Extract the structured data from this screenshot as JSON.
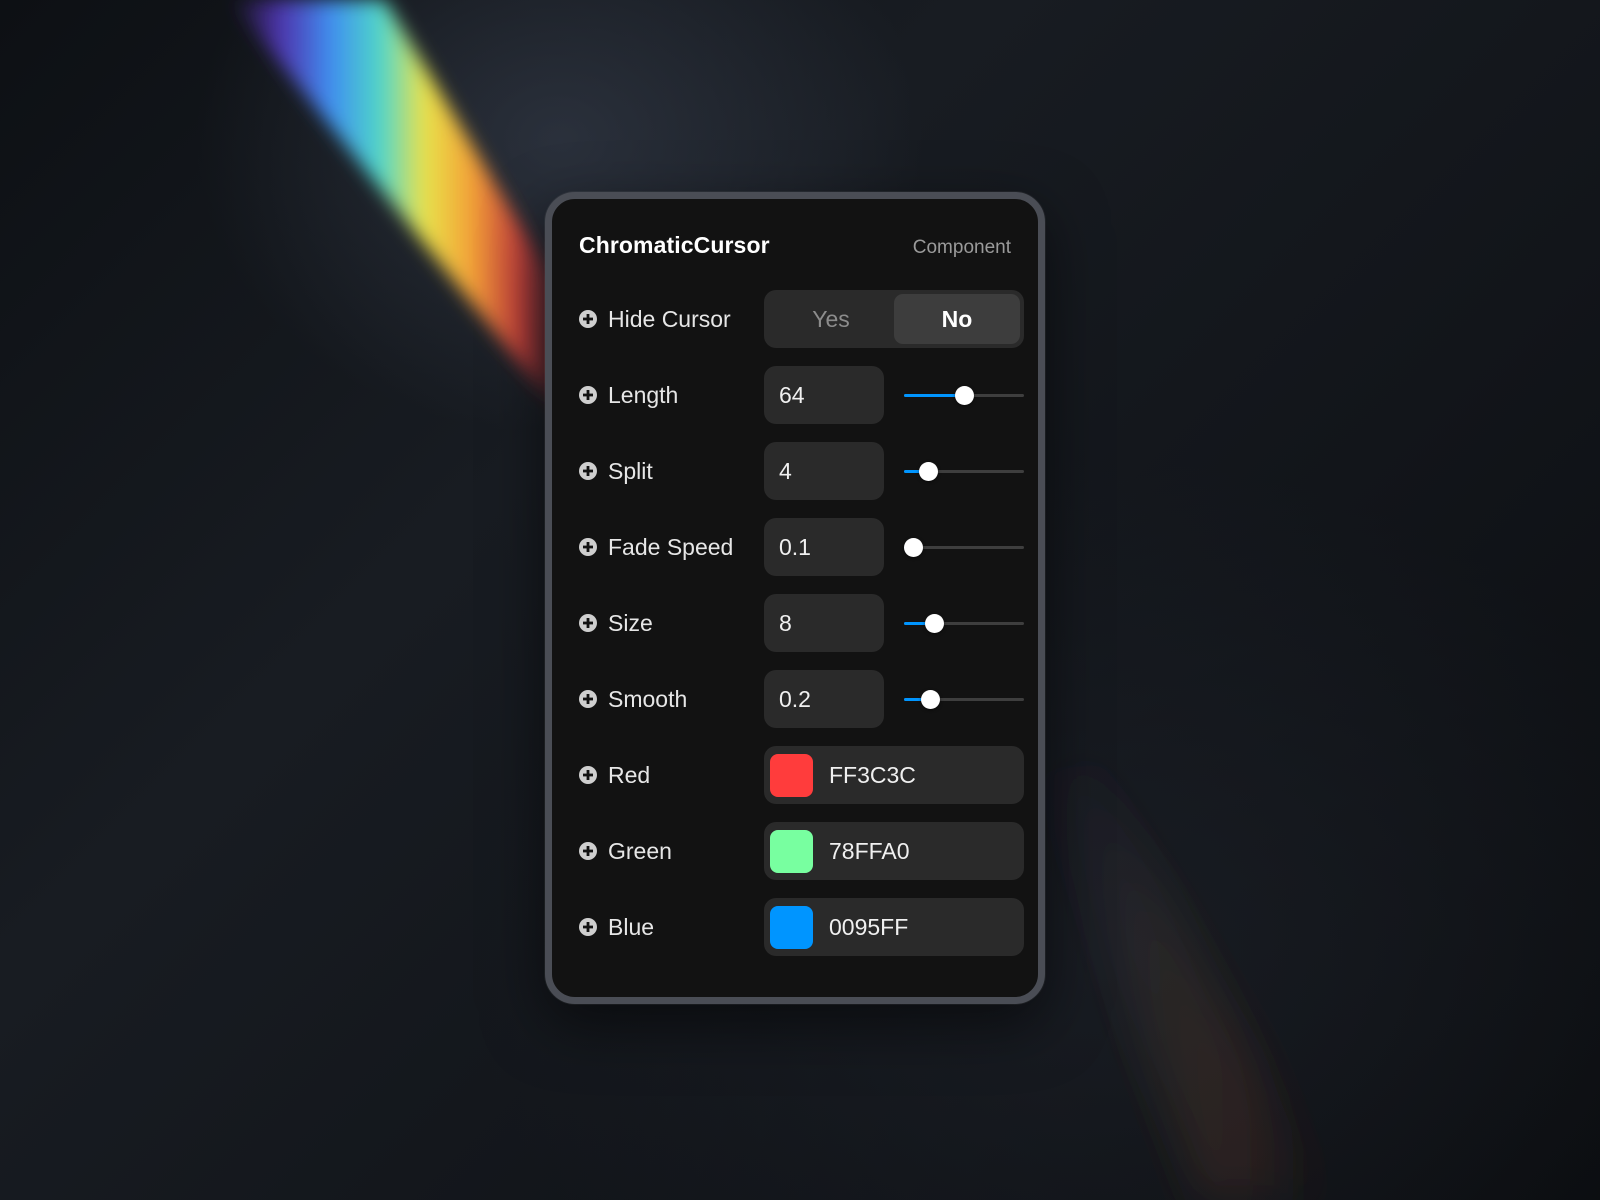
{
  "panel": {
    "title": "ChromaticCursor",
    "subtitle": "Component"
  },
  "hide_cursor": {
    "label": "Hide Cursor",
    "options": [
      "Yes",
      "No"
    ],
    "selected": "No"
  },
  "length": {
    "label": "Length",
    "value": "64",
    "level": 0.5
  },
  "split": {
    "label": "Split",
    "value": "4",
    "level": 0.2
  },
  "fade_speed": {
    "label": "Fade Speed",
    "value": "0.1",
    "level": 0.07
  },
  "size": {
    "label": "Size",
    "value": "8",
    "level": 0.25
  },
  "smooth": {
    "label": "Smooth",
    "value": "0.2",
    "level": 0.22
  },
  "red": {
    "label": "Red",
    "hex": "FF3C3C",
    "color": "#FF3C3C"
  },
  "green": {
    "label": "Green",
    "hex": "78FFA0",
    "color": "#78FFA0"
  },
  "blue": {
    "label": "Blue",
    "hex": "0095FF",
    "color": "#0095FF"
  },
  "colors": {
    "accent": "#0095FF",
    "panel_bg": "#121212"
  },
  "icons": {
    "add": "plus-circle-icon"
  }
}
